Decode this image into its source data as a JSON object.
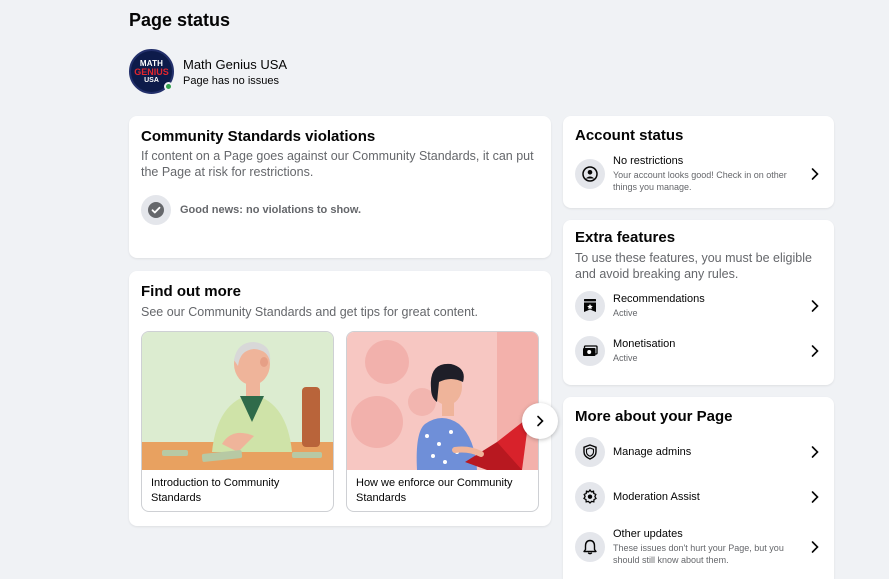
{
  "page": {
    "title": "Page status"
  },
  "profile": {
    "name": "Math Genius USA",
    "status": "Page has no issues",
    "avatar_text": {
      "top": "MATH",
      "mid": "GENIUS",
      "bot": "USA"
    },
    "online_color": "#31a24c"
  },
  "violations": {
    "title": "Community Standards violations",
    "description": "If content on a Page goes against our Community Standards, it can put the Page at risk for restrictions.",
    "status_text": "Good news: no violations to show.",
    "status_icon": "check-circle-icon"
  },
  "find_out": {
    "title": "Find out more",
    "description": "See our Community Standards and get tips for great content.",
    "tiles": [
      {
        "caption": "Introduction to Community Standards",
        "art": "elderly-man-at-table-illustration"
      },
      {
        "caption": "How we enforce our Community Standards",
        "art": "woman-with-laptop-illustration"
      }
    ],
    "next_icon": "chevron-right-icon"
  },
  "account_status": {
    "title": "Account status",
    "items": [
      {
        "title": "No restrictions",
        "subtitle": "Your account looks good! Check in on other things you manage.",
        "icon": "person-circle-icon"
      }
    ]
  },
  "extra_features": {
    "title": "Extra features",
    "description": "To use these features, you must be eligible and avoid breaking any rules.",
    "items": [
      {
        "title": "Recommendations",
        "subtitle": "Active",
        "icon": "recommendations-icon"
      },
      {
        "title": "Monetisation",
        "subtitle": "Active",
        "icon": "money-icon"
      }
    ]
  },
  "more_about": {
    "title": "More about your Page",
    "items": [
      {
        "title": "Manage admins",
        "subtitle": "",
        "icon": "shield-icon"
      },
      {
        "title": "Moderation Assist",
        "subtitle": "",
        "icon": "gear-icon"
      },
      {
        "title": "Other updates",
        "subtitle": "These issues don't hurt your Page, but you should still know about them.",
        "icon": "bell-icon"
      }
    ]
  },
  "colors": {
    "background": "#f0f2f5",
    "card": "#ffffff",
    "secondary_text": "#65676b",
    "icon_bg": "#e4e6eb"
  }
}
